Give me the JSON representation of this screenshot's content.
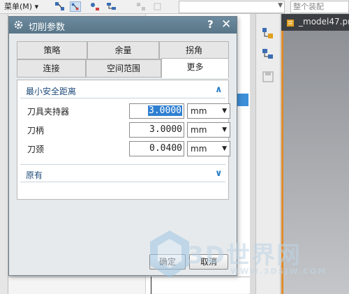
{
  "toolbar": {
    "menu_label": "菜单(M)",
    "menu_arrow": "▾",
    "filter_value": "",
    "scope_value": "整个装配"
  },
  "graphics_tab": {
    "label": "_model47.pr"
  },
  "dialog": {
    "title": "切削参数",
    "help": "?",
    "close": "✕",
    "tabs_row1": [
      {
        "label": "策略"
      },
      {
        "label": "余量"
      },
      {
        "label": "拐角"
      }
    ],
    "tabs_row2": [
      {
        "label": "连接"
      },
      {
        "label": "空间范围"
      },
      {
        "label": "更多",
        "active": true
      }
    ],
    "section_min_clearance": {
      "title": "最小安全距离",
      "chevron": "∧",
      "rows": [
        {
          "label": "刀具夹持器",
          "value": "3.0000",
          "unit": "mm",
          "selected": true
        },
        {
          "label": "刀柄",
          "value": "3.0000",
          "unit": "mm"
        },
        {
          "label": "刀颈",
          "value": "0.0400",
          "unit": "mm"
        }
      ]
    },
    "section_legacy": {
      "title": "原有",
      "chevron": "∨"
    },
    "ok_label": "确定",
    "cancel_label": "取消"
  },
  "watermark": {
    "text": "3D世界网",
    "url": "WWW.3DSJW.COM"
  },
  "colors": {
    "title_bar": "#5f7d91",
    "accent": "#2f7fd1",
    "section_text": "#1e4a7a",
    "viewport_border": "#e08b2a"
  }
}
